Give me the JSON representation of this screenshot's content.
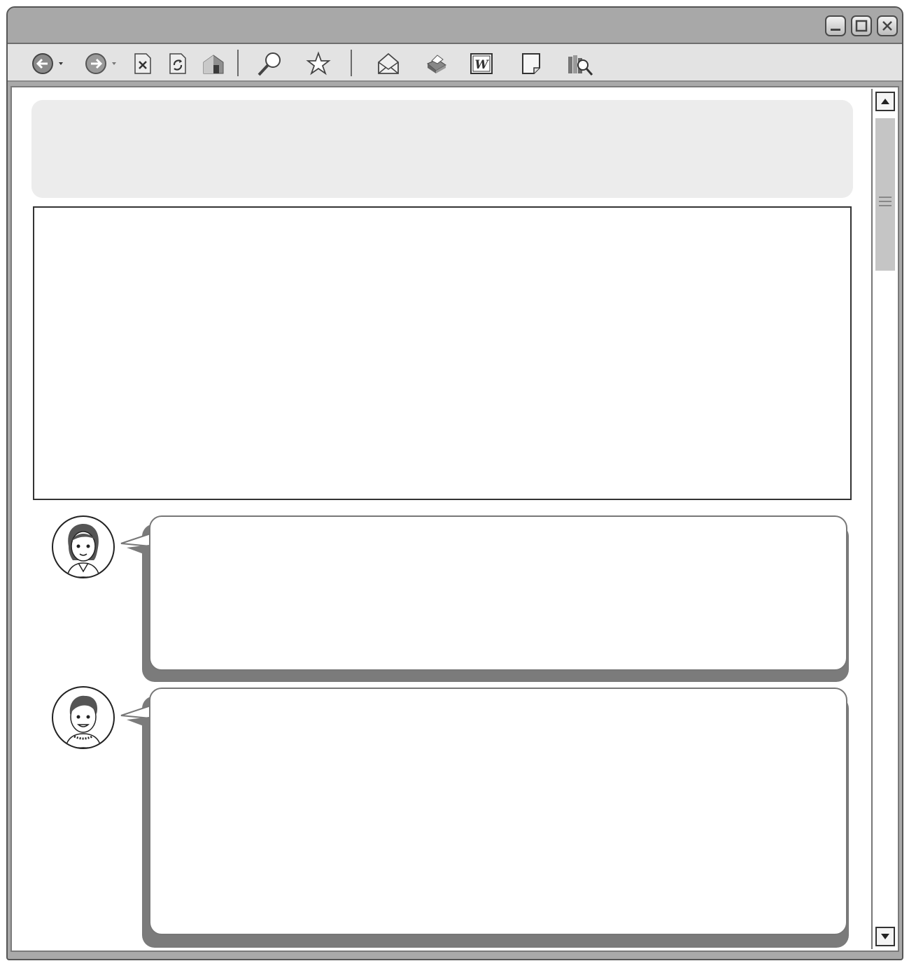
{
  "window": {
    "controls": [
      {
        "name": "minimize-icon"
      },
      {
        "name": "maximize-icon"
      },
      {
        "name": "close-icon"
      }
    ]
  },
  "toolbar": {
    "buttons": [
      {
        "name": "back-icon"
      },
      {
        "name": "forward-icon"
      },
      {
        "name": "stop-icon"
      },
      {
        "name": "refresh-icon"
      },
      {
        "name": "home-icon"
      },
      {
        "name": "search-icon"
      },
      {
        "name": "favorites-star-icon"
      },
      {
        "name": "mail-icon"
      },
      {
        "name": "print-icon"
      },
      {
        "name": "word-document-icon"
      },
      {
        "name": "note-page-icon"
      },
      {
        "name": "research-icon"
      }
    ],
    "word_glyph": "W"
  },
  "conversation": [
    {
      "speaker": "female-avatar",
      "text": ""
    },
    {
      "speaker": "male-avatar",
      "text": ""
    }
  ],
  "colors": {
    "frame": "#a9a9a9",
    "toolbar": "#e3e3e3",
    "header_panel": "#ececec",
    "bubble_shadow": "#7b7b7b"
  }
}
